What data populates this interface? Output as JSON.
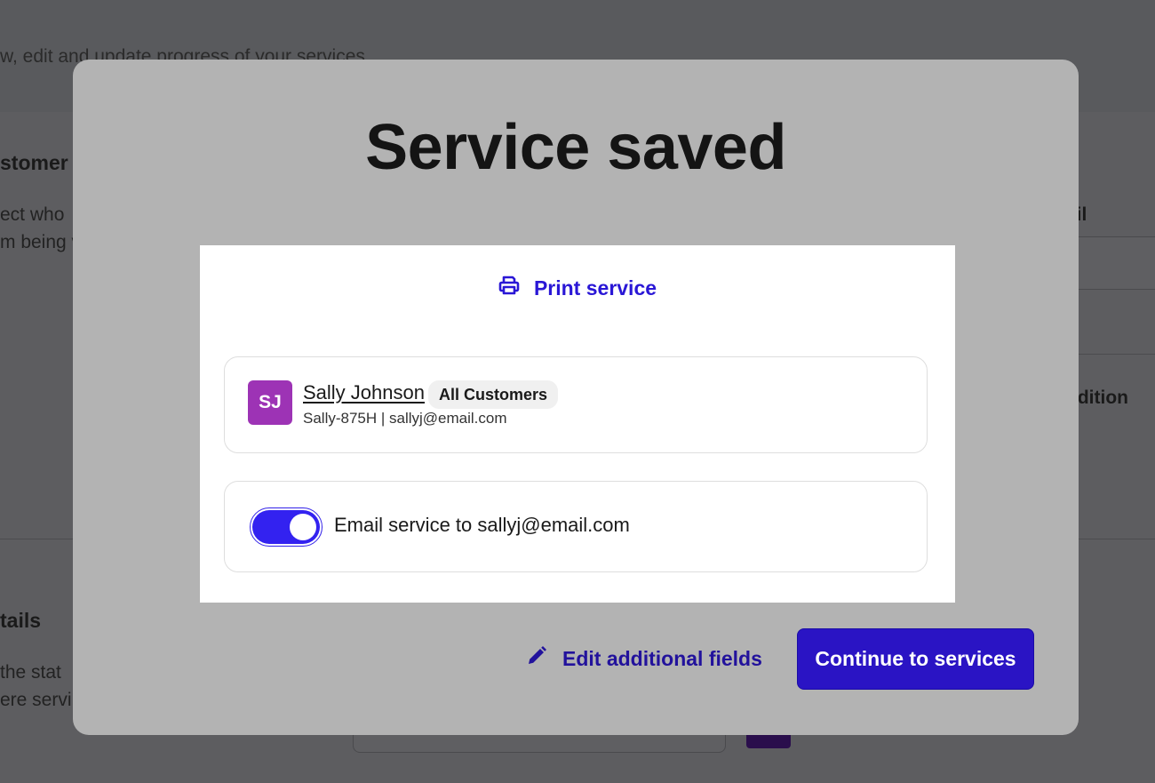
{
  "background": {
    "subtitle": "w, edit and update progress of your services",
    "customer_heading": "stomer",
    "customer_desc_line1": "ect who",
    "customer_desc_line2": "m being v",
    "right_label_top": "ail",
    "right_label_mid": "ndition",
    "details_heading": "tails",
    "details_desc_line1": " the stat",
    "details_desc_line2": "ere servi"
  },
  "modal": {
    "title": "Service saved",
    "print_label": "Print service",
    "customer": {
      "initials": "SJ",
      "name": "Sally Johnson",
      "badge": "All Customers",
      "details": "Sally-875H | sallyj@email.com",
      "avatar_color": "#9d33b5"
    },
    "email_toggle": {
      "on": true,
      "label": "Email service to sallyj@email.com"
    },
    "edit_label": "Edit additional fields",
    "continue_label": "Continue to services"
  },
  "colors": {
    "accent": "#2a14c4",
    "link": "#2a17d6",
    "toggle": "#3322f0"
  },
  "icons": {
    "print": "printer-icon",
    "edit": "pencil-icon"
  }
}
